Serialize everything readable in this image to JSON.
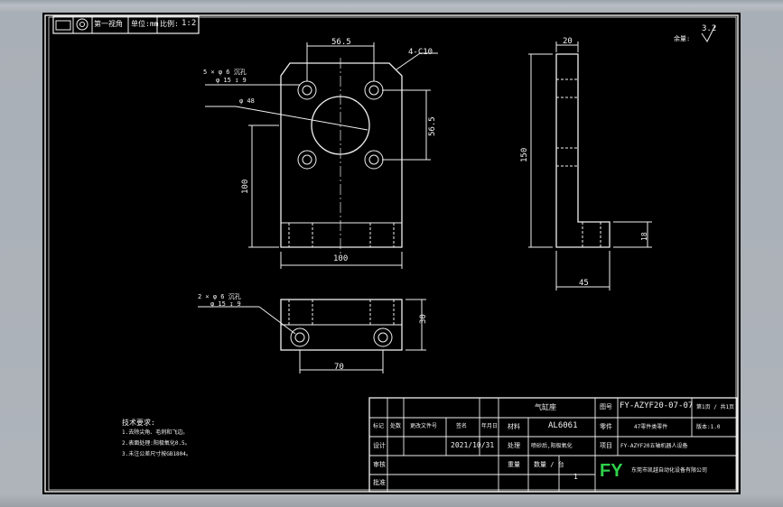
{
  "header": {
    "views": "第一视角",
    "unit": "单位:mm",
    "scale_label": "比例:",
    "scale_value": "1:2"
  },
  "roughness": {
    "other_label": "余量:",
    "value": "3.2"
  },
  "front_view": {
    "dim_top": "56.5",
    "dim_right": "56.5",
    "dim_left": "100",
    "dim_bottom": "100",
    "chamfer": "4-C10",
    "hole_callout_line1": "5 × φ 6 沉孔",
    "hole_callout_line2": "φ 15 ↧ 9",
    "bore_callout": "φ 48"
  },
  "side_view": {
    "dim_top": "20",
    "dim_height": "150",
    "dim_foot": "18",
    "dim_bottom": "45"
  },
  "top_view": {
    "hole_callout_line1": "2 × φ 6 沉孔",
    "hole_callout_line2": "φ 15 ↧ 9",
    "dim_right": "30",
    "dim_bottom": "70"
  },
  "tech_notes": {
    "title": "技术要求:",
    "items": [
      "1.去除尖角、毛刺和飞边。",
      "2.表面处理:阳极氧化0.5。",
      "3.未注公差尺寸按GB1804。"
    ]
  },
  "title_block": {
    "part_name": "气缸座",
    "drawing_no_label": "图号",
    "drawing_no": "FY-AZYF20-07-07",
    "sheet": "第1页 / 共1页",
    "material_label": "材料",
    "material": "AL6061",
    "part_label": "零件",
    "part_desc": "47零件类零件",
    "revision": "版本:1.0",
    "row_labels": [
      "标记",
      "处数",
      "更改文件号",
      "签名",
      "年月日"
    ],
    "design_label": "设计",
    "date": "2021/10/31",
    "treatment_label": "处理",
    "treatment": "喷砂后,阳极氧化",
    "project_label": "项目",
    "project": "FY-AZYF20五轴机器人设备",
    "check_label": "审核",
    "approve_label": "批准",
    "qty_label": "数量 / 台",
    "qty": "1",
    "weight_label": "重量",
    "logo": "FY",
    "company": "东莞市凯越自动化设备有限公司"
  }
}
